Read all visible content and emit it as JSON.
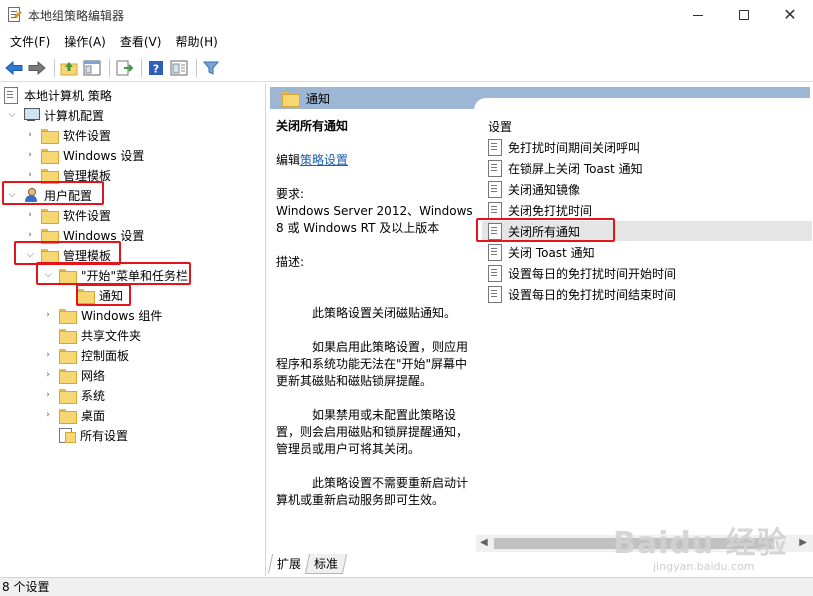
{
  "window": {
    "title": "本地组策略编辑器",
    "minimize": "—",
    "maximize": "□",
    "close": "✕"
  },
  "menu": {
    "file": "文件(F)",
    "action": "操作(A)",
    "view": "查看(V)",
    "help": "帮助(H)"
  },
  "toolbar_icons": [
    "back-arrow-icon",
    "forward-arrow-icon",
    "up-folder-icon",
    "show-hide-tree-icon",
    "export-list-icon",
    "help-icon",
    "properties-icon",
    "filter-icon"
  ],
  "tree": {
    "root": "本地计算机 策略",
    "computer_config": "计算机配置",
    "cc_software": "软件设置",
    "cc_windows": "Windows 设置",
    "cc_admin": "管理模板",
    "user_config": "用户配置",
    "uc_software": "软件设置",
    "uc_windows": "Windows 设置",
    "uc_admin": "管理模板",
    "start_menu": "\"开始\"菜单和任务栏",
    "notifications": "通知",
    "windows_components": "Windows 组件",
    "shared_folders": "共享文件夹",
    "control_panel": "控制面板",
    "network": "网络",
    "system": "系统",
    "desktop": "桌面",
    "all_settings": "所有设置"
  },
  "right": {
    "header": "通知",
    "policy_title": "关闭所有通知",
    "edit_prefix": "编辑",
    "edit_link": "策略设置",
    "requirements_label": "要求:",
    "requirements": "Windows Server 2012、Windows 8 或 Windows RT 及以上版本",
    "description_label": "描述:",
    "para1": "此策略设置关闭磁贴通知。",
    "para2": "如果启用此策略设置，则应用程序和系统功能无法在\"开始\"屏幕中更新其磁贴和磁贴锁屏提醒。",
    "para3": "如果禁用或未配置此策略设置，则会启用磁贴和锁屏提醒通知，管理员或用户可将其关闭。",
    "para4": "此策略设置不需要重新启动计算机或重新启动服务即可生效。",
    "column_header": "设置",
    "settings": [
      "免打扰时间期间关闭呼叫",
      "在锁屏上关闭 Toast 通知",
      "关闭通知镜像",
      "关闭免打扰时间",
      "关闭所有通知",
      "关闭 Toast 通知",
      "设置每日的免打扰时间开始时间",
      "设置每日的免打扰时间结束时间"
    ],
    "tab_extended": "扩展",
    "tab_standard": "标准"
  },
  "status": "8 个设置",
  "watermark": {
    "main": "Baidu 经验",
    "sub": "jingyan.baidu.com"
  },
  "colors": {
    "highlight_box": "#e3141b",
    "header_bar": "#9cb6d4",
    "link": "#1a5fb4"
  }
}
